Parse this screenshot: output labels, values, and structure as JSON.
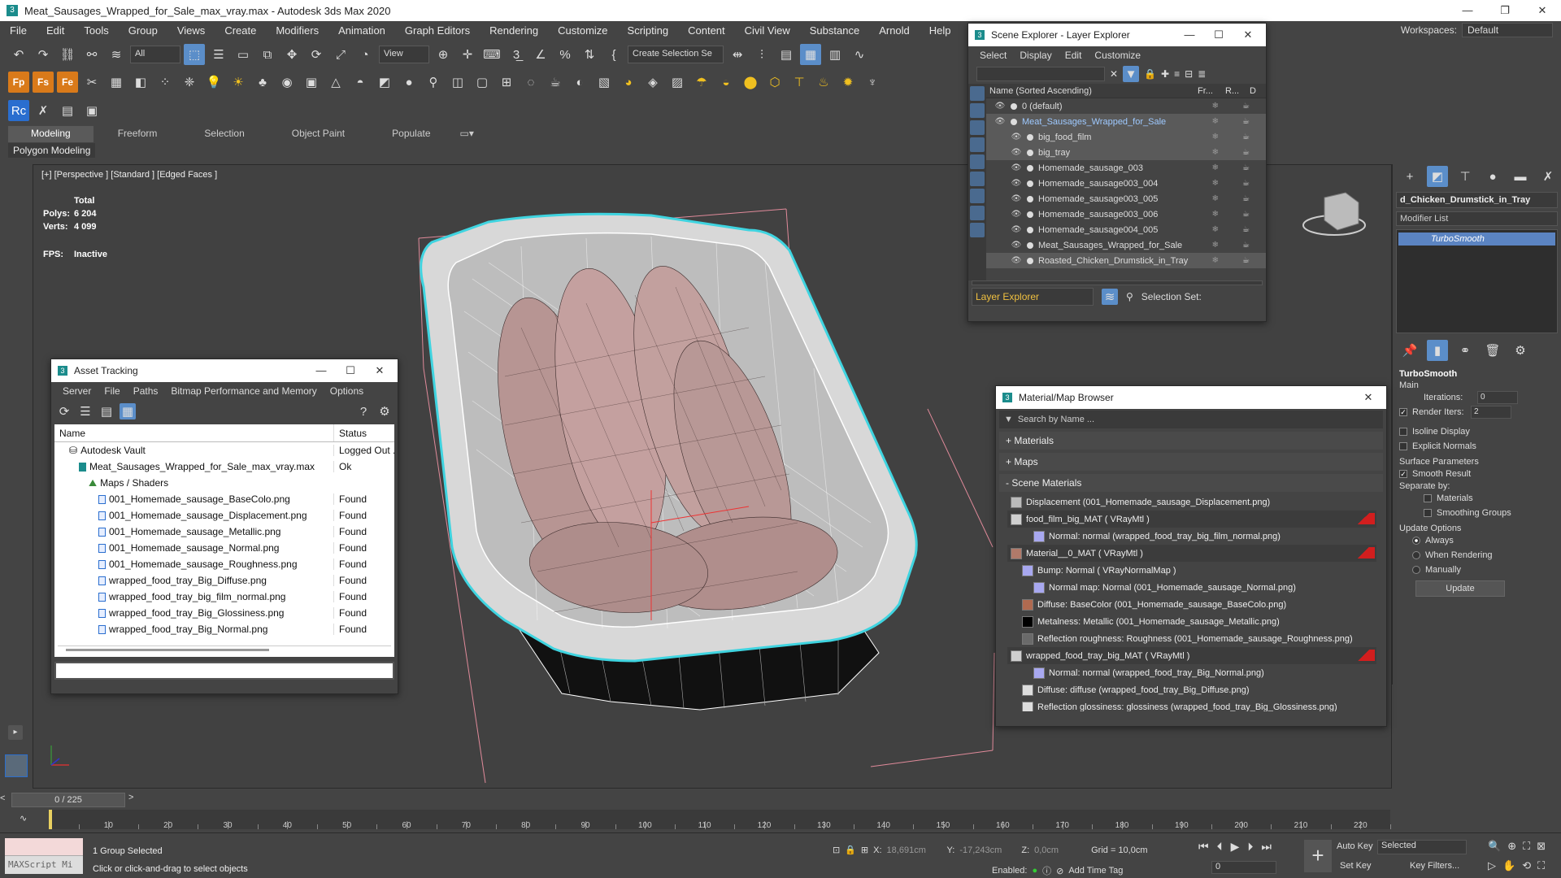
{
  "window": {
    "title": "Meat_Sausages_Wrapped_for_Sale_max_vray.max - Autodesk 3ds Max 2020",
    "app_icon": "3",
    "controls": [
      "—",
      "❐",
      "✕"
    ]
  },
  "menu": [
    "File",
    "Edit",
    "Tools",
    "Group",
    "Views",
    "Create",
    "Modifiers",
    "Animation",
    "Graph Editors",
    "Rendering",
    "Customize",
    "Scripting",
    "Content",
    "Civil View",
    "Substance",
    "Arnold",
    "Help"
  ],
  "workspaces": {
    "label": "Workspaces:",
    "value": "Default"
  },
  "toolbar": {
    "selection_filter": "All",
    "ref_coord": "View",
    "named_selection": "Create Selection Se"
  },
  "ribbon": {
    "tabs": [
      "Modeling",
      "Freeform",
      "Selection",
      "Object Paint",
      "Populate"
    ],
    "active_tab": "Modeling",
    "sub_label": "Polygon Modeling"
  },
  "viewport": {
    "label": "[+] [Perspective ] [Standard ] [Edged Faces ]",
    "stats": {
      "total_label": "Total",
      "polys_label": "Polys:",
      "polys": "6 204",
      "verts_label": "Verts:",
      "verts": "4 099",
      "fps_label": "FPS:",
      "fps": "Inactive"
    }
  },
  "scene_explorer": {
    "title": "Scene Explorer - Layer Explorer",
    "menu": [
      "Select",
      "Display",
      "Edit",
      "Customize"
    ],
    "col_name": "Name (Sorted Ascending)",
    "col_fr": "Fr...",
    "col_r": "R...",
    "col_d": "D",
    "rows": [
      {
        "name": "0 (default)",
        "indent": 0,
        "highlight": false,
        "link": false
      },
      {
        "name": "Meat_Sausages_Wrapped_for_Sale",
        "indent": 0,
        "highlight": true,
        "link": true
      },
      {
        "name": "big_food_film",
        "indent": 1,
        "highlight": true,
        "link": false
      },
      {
        "name": "big_tray",
        "indent": 1,
        "highlight": true,
        "link": false
      },
      {
        "name": "Homemade_sausage_003",
        "indent": 1,
        "highlight": false,
        "link": false
      },
      {
        "name": "Homemade_sausage003_004",
        "indent": 1,
        "highlight": false,
        "link": false
      },
      {
        "name": "Homemade_sausage003_005",
        "indent": 1,
        "highlight": false,
        "link": false
      },
      {
        "name": "Homemade_sausage003_006",
        "indent": 1,
        "highlight": false,
        "link": false
      },
      {
        "name": "Homemade_sausage004_005",
        "indent": 1,
        "highlight": false,
        "link": false
      },
      {
        "name": "Meat_Sausages_Wrapped_for_Sale",
        "indent": 1,
        "highlight": false,
        "link": false
      },
      {
        "name": "Roasted_Chicken_Drumstick_in_Tray",
        "indent": 1,
        "highlight": true,
        "link": false
      }
    ],
    "footer_explorer": "Layer Explorer",
    "selection_set_label": "Selection Set:"
  },
  "asset_tracking": {
    "title": "Asset Tracking",
    "menu": [
      "Server",
      "File",
      "Paths",
      "Bitmap Performance and Memory",
      "Options"
    ],
    "col_name": "Name",
    "col_status": "Status",
    "rows": [
      {
        "name": "Autodesk Vault",
        "status": "Logged Out ...",
        "indent": 1,
        "icon": "vault"
      },
      {
        "name": "Meat_Sausages_Wrapped_for_Sale_max_vray.max",
        "status": "Ok",
        "indent": 2,
        "icon": "max"
      },
      {
        "name": "Maps / Shaders",
        "status": "",
        "indent": 3,
        "icon": "maps"
      },
      {
        "name": "001_Homemade_sausage_BaseColo.png",
        "status": "Found",
        "indent": 4,
        "icon": "file"
      },
      {
        "name": "001_Homemade_sausage_Displacement.png",
        "status": "Found",
        "indent": 4,
        "icon": "file"
      },
      {
        "name": "001_Homemade_sausage_Metallic.png",
        "status": "Found",
        "indent": 4,
        "icon": "file"
      },
      {
        "name": "001_Homemade_sausage_Normal.png",
        "status": "Found",
        "indent": 4,
        "icon": "file"
      },
      {
        "name": "001_Homemade_sausage_Roughness.png",
        "status": "Found",
        "indent": 4,
        "icon": "file"
      },
      {
        "name": "wrapped_food_tray_Big_Diffuse.png",
        "status": "Found",
        "indent": 4,
        "icon": "file"
      },
      {
        "name": "wrapped_food_tray_big_film_normal.png",
        "status": "Found",
        "indent": 4,
        "icon": "file"
      },
      {
        "name": "wrapped_food_tray_Big_Glossiness.png",
        "status": "Found",
        "indent": 4,
        "icon": "file"
      },
      {
        "name": "wrapped_food_tray_Big_Normal.png",
        "status": "Found",
        "indent": 4,
        "icon": "file"
      }
    ]
  },
  "material_browser": {
    "title": "Material/Map Browser",
    "search_placeholder": "Search by Name ...",
    "sections": [
      "+ Materials",
      "+ Maps",
      "- Scene Materials"
    ],
    "items": [
      {
        "text": "Displacement (001_Homemade_sausage_Displacement.png)",
        "indent": 0,
        "swatch": "#bbbbbb",
        "hdr": false,
        "flag": false
      },
      {
        "text": "food_film_big_MAT  ( VRayMtl )",
        "indent": 0,
        "swatch": "#cfcfcf",
        "hdr": true,
        "flag": true
      },
      {
        "text": "Normal: normal (wrapped_food_tray_big_film_normal.png)",
        "indent": 2,
        "swatch": "#a8a8f0",
        "hdr": false,
        "flag": false
      },
      {
        "text": "Material__0_MAT  ( VRayMtl )",
        "indent": 0,
        "swatch": "#b07a6a",
        "hdr": true,
        "flag": true
      },
      {
        "text": "Bump: Normal  ( VRayNormalMap )",
        "indent": 1,
        "swatch": "#a8a8f0",
        "hdr": false,
        "flag": false
      },
      {
        "text": "Normal map: Normal (001_Homemade_sausage_Normal.png)",
        "indent": 2,
        "swatch": "#a8a8f0",
        "hdr": false,
        "flag": false
      },
      {
        "text": "Diffuse: BaseColor (001_Homemade_sausage_BaseColo.png)",
        "indent": 1,
        "swatch": "#b06a50",
        "hdr": false,
        "flag": false
      },
      {
        "text": "Metalness: Metallic (001_Homemade_sausage_Metallic.png)",
        "indent": 1,
        "swatch": "#000000",
        "hdr": false,
        "flag": false
      },
      {
        "text": "Reflection roughness: Roughness (001_Homemade_sausage_Roughness.png)",
        "indent": 1,
        "swatch": "#6a6a6a",
        "hdr": false,
        "flag": false
      },
      {
        "text": "wrapped_food_tray_big_MAT  ( VRayMtl )",
        "indent": 0,
        "swatch": "#cfcfcf",
        "hdr": true,
        "flag": true
      },
      {
        "text": "Normal: normal (wrapped_food_tray_Big_Normal.png)",
        "indent": 2,
        "swatch": "#a8a8f0",
        "hdr": false,
        "flag": false
      },
      {
        "text": "Diffuse: diffuse (wrapped_food_tray_Big_Diffuse.png)",
        "indent": 1,
        "swatch": "#dddddd",
        "hdr": false,
        "flag": false
      },
      {
        "text": "Reflection glossiness: glossiness (wrapped_food_tray_Big_Glossiness.png)",
        "indent": 1,
        "swatch": "#dddddd",
        "hdr": false,
        "flag": false
      }
    ]
  },
  "command_panel": {
    "object_name": "d_Chicken_Drumstick_in_Tray",
    "modifier_list": "Modifier List",
    "stack_item": "TurboSmooth",
    "rollout": {
      "title": "TurboSmooth",
      "main": "Main",
      "iterations_label": "Iterations:",
      "iterations": "0",
      "render_iters_label": "Render Iters:",
      "render_iters": "2",
      "isoline": "Isoline Display",
      "explicit": "Explicit Normals",
      "surface_params": "Surface Parameters",
      "smooth_result": "Smooth Result",
      "separate_by": "Separate by:",
      "materials": "Materials",
      "smoothing_groups": "Smoothing Groups",
      "update_options": "Update Options",
      "always": "Always",
      "when_rendering": "When Rendering",
      "manually": "Manually",
      "update_btn": "Update"
    }
  },
  "timeline": {
    "slider": "0 / 225",
    "ticks": [
      "10",
      "20",
      "30",
      "40",
      "50",
      "60",
      "70",
      "80",
      "90",
      "100",
      "110",
      "120",
      "130",
      "140",
      "150",
      "160",
      "170",
      "180",
      "190",
      "200",
      "210",
      "220"
    ]
  },
  "statusbar": {
    "maxscript": "MAXScript Mi",
    "line1": "1 Group Selected",
    "line2": "Click or click-and-drag to select objects",
    "x_label": "X:",
    "x": "18,691cm",
    "y_label": "Y:",
    "y": "-17,243cm",
    "z_label": "Z:",
    "z": "0,0cm",
    "grid": "Grid = 10,0cm",
    "enabled": "Enabled:",
    "add_time_tag": "Add Time Tag",
    "auto_key": "Auto Key",
    "set_key": "Set Key",
    "selected": "Selected",
    "key_filters": "Key Filters...",
    "frame": "0"
  }
}
